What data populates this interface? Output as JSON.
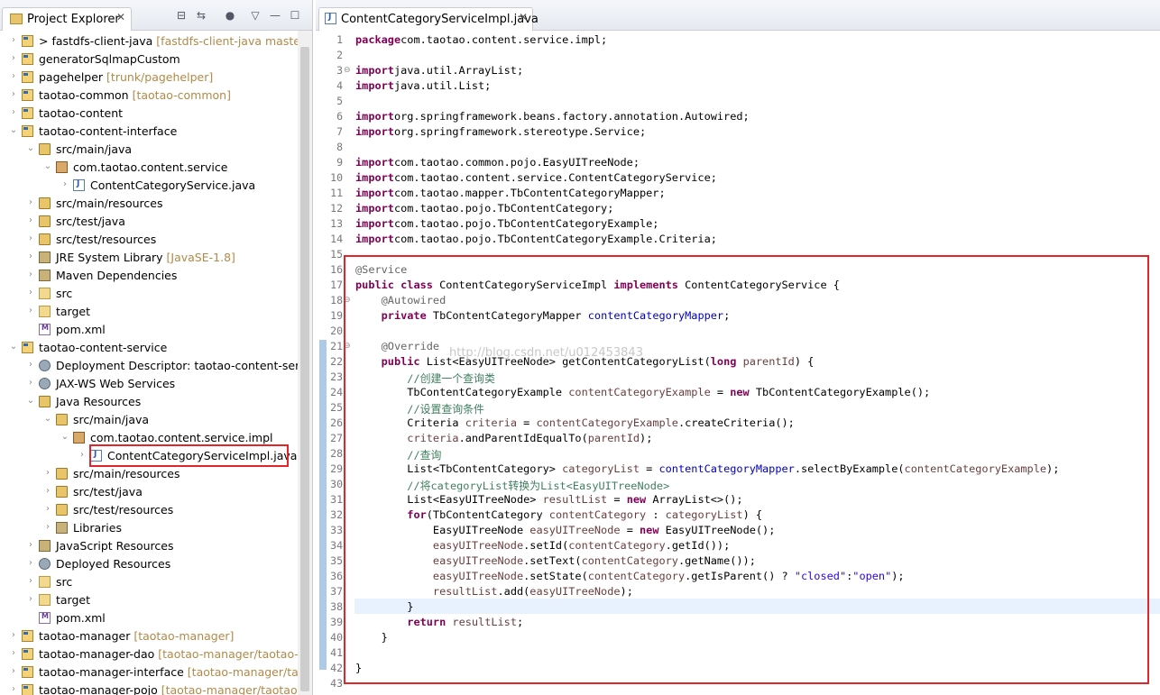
{
  "explorer": {
    "title": "Project Explorer",
    "tree": [
      {
        "label": "> fastdfs-client-java",
        "deco": " [fastdfs-client-java master]",
        "icon": "maven-project-icon",
        "depth": 0,
        "expanded": false
      },
      {
        "label": "generatorSqlmapCustom",
        "deco": "",
        "icon": "project-icon",
        "depth": 0,
        "expanded": false
      },
      {
        "label": "pagehelper",
        "deco": " [trunk/pagehelper]",
        "icon": "maven-project-icon",
        "depth": 0,
        "expanded": false
      },
      {
        "label": "taotao-common",
        "deco": " [taotao-common]",
        "icon": "maven-project-icon",
        "depth": 0,
        "expanded": false
      },
      {
        "label": "taotao-content",
        "deco": "",
        "icon": "maven-project-icon",
        "depth": 0,
        "expanded": false
      },
      {
        "label": "taotao-content-interface",
        "deco": "",
        "icon": "maven-project-icon",
        "depth": 0,
        "expanded": true
      },
      {
        "label": "src/main/java",
        "deco": "",
        "icon": "source-folder-icon",
        "depth": 1,
        "expanded": true
      },
      {
        "label": "com.taotao.content.service",
        "deco": "",
        "icon": "package-icon",
        "depth": 2,
        "expanded": true
      },
      {
        "label": "ContentCategoryService.java",
        "deco": "",
        "icon": "java-file-icon",
        "depth": 3,
        "expanded": false
      },
      {
        "label": "src/main/resources",
        "deco": "",
        "icon": "source-folder-icon",
        "depth": 1,
        "expanded": false
      },
      {
        "label": "src/test/java",
        "deco": "",
        "icon": "source-folder-icon",
        "depth": 1,
        "expanded": false
      },
      {
        "label": "src/test/resources",
        "deco": "",
        "icon": "source-folder-icon",
        "depth": 1,
        "expanded": false
      },
      {
        "label": "JRE System Library",
        "deco": " [JavaSE-1.8]",
        "icon": "library-icon",
        "depth": 1,
        "expanded": false
      },
      {
        "label": "Maven Dependencies",
        "deco": "",
        "icon": "library-icon",
        "depth": 1,
        "expanded": false
      },
      {
        "label": "src",
        "deco": "",
        "icon": "folder-icon",
        "depth": 1,
        "expanded": false
      },
      {
        "label": "target",
        "deco": "",
        "icon": "folder-icon",
        "depth": 1,
        "expanded": false
      },
      {
        "label": "pom.xml",
        "deco": "",
        "icon": "xml-file-icon",
        "depth": 1,
        "leaf": true
      },
      {
        "label": "taotao-content-service",
        "deco": "",
        "icon": "maven-project-icon",
        "depth": 0,
        "expanded": true
      },
      {
        "label": "Deployment Descriptor: taotao-content-servi",
        "deco": "",
        "icon": "deployment-icon",
        "depth": 1,
        "expanded": false
      },
      {
        "label": "JAX-WS Web Services",
        "deco": "",
        "icon": "webservice-icon",
        "depth": 1,
        "expanded": false
      },
      {
        "label": "Java Resources",
        "deco": "",
        "icon": "java-resources-icon",
        "depth": 1,
        "expanded": true
      },
      {
        "label": "src/main/java",
        "deco": "",
        "icon": "source-folder-icon",
        "depth": 2,
        "expanded": true
      },
      {
        "label": "com.taotao.content.service.impl",
        "deco": "",
        "icon": "package-icon",
        "depth": 3,
        "expanded": true
      },
      {
        "label": "ContentCategoryServiceImpl.java",
        "deco": "",
        "icon": "java-file-icon",
        "depth": 4,
        "expanded": false,
        "selected": true
      },
      {
        "label": "src/main/resources",
        "deco": "",
        "icon": "source-folder-icon",
        "depth": 2,
        "expanded": false
      },
      {
        "label": "src/test/java",
        "deco": "",
        "icon": "source-folder-icon",
        "depth": 2,
        "expanded": false
      },
      {
        "label": "src/test/resources",
        "deco": "",
        "icon": "source-folder-icon",
        "depth": 2,
        "expanded": false
      },
      {
        "label": "Libraries",
        "deco": "",
        "icon": "library-icon",
        "depth": 2,
        "expanded": false
      },
      {
        "label": "JavaScript Resources",
        "deco": "",
        "icon": "javascript-icon",
        "depth": 1,
        "expanded": false
      },
      {
        "label": "Deployed Resources",
        "deco": "",
        "icon": "deployed-icon",
        "depth": 1,
        "expanded": false
      },
      {
        "label": "src",
        "deco": "",
        "icon": "folder-icon",
        "depth": 1,
        "expanded": false
      },
      {
        "label": "target",
        "deco": "",
        "icon": "folder-icon",
        "depth": 1,
        "expanded": false
      },
      {
        "label": "pom.xml",
        "deco": "",
        "icon": "xml-file-icon",
        "depth": 1,
        "leaf": true
      },
      {
        "label": "taotao-manager",
        "deco": " [taotao-manager]",
        "icon": "maven-project-icon",
        "depth": 0,
        "expanded": false
      },
      {
        "label": "taotao-manager-dao",
        "deco": " [taotao-manager/taotao-m",
        "icon": "maven-project-icon",
        "depth": 0,
        "expanded": false
      },
      {
        "label": "taotao-manager-interface",
        "deco": " [taotao-manager/taot",
        "icon": "maven-project-icon",
        "depth": 0,
        "expanded": false
      },
      {
        "label": "taotao-manager-pojo",
        "deco": " [taotao-manager/taotao-",
        "icon": "maven-project-icon",
        "depth": 0,
        "expanded": false
      }
    ]
  },
  "editor": {
    "tab_title": "ContentCategoryServiceImpl.java",
    "watermark": "http://blog.csdn.net/u012453843",
    "lines": [
      {
        "n": "1",
        "t": [
          [
            "kw",
            "package"
          ],
          [
            "",
            "com.taotao.content.service.impl;"
          ]
        ]
      },
      {
        "n": "2",
        "t": []
      },
      {
        "n": "3",
        "fold": true,
        "t": [
          [
            "kw",
            "import"
          ],
          [
            "",
            "java.util.ArrayList;"
          ]
        ]
      },
      {
        "n": "4",
        "t": [
          [
            "kw",
            "import"
          ],
          [
            "",
            "java.util.List;"
          ]
        ]
      },
      {
        "n": "5",
        "t": []
      },
      {
        "n": "6",
        "t": [
          [
            "kw",
            "import"
          ],
          [
            "",
            "org.springframework.beans.factory.annotation.Autowired;"
          ]
        ]
      },
      {
        "n": "7",
        "t": [
          [
            "kw",
            "import"
          ],
          [
            "",
            "org.springframework.stereotype.Service;"
          ]
        ]
      },
      {
        "n": "8",
        "t": []
      },
      {
        "n": "9",
        "t": [
          [
            "kw",
            "import"
          ],
          [
            "",
            "com.taotao.common.pojo.EasyUITreeNode;"
          ]
        ]
      },
      {
        "n": "10",
        "t": [
          [
            "kw",
            "import"
          ],
          [
            "",
            "com.taotao.content.service.ContentCategoryService;"
          ]
        ]
      },
      {
        "n": "11",
        "t": [
          [
            "kw",
            "import"
          ],
          [
            "",
            "com.taotao.mapper.TbContentCategoryMapper;"
          ]
        ]
      },
      {
        "n": "12",
        "t": [
          [
            "kw",
            "import"
          ],
          [
            "",
            "com.taotao.pojo.TbContentCategory;"
          ]
        ]
      },
      {
        "n": "13",
        "t": [
          [
            "kw",
            "import"
          ],
          [
            "",
            "com.taotao.pojo.TbContentCategoryExample;"
          ]
        ]
      },
      {
        "n": "14",
        "t": [
          [
            "kw",
            "import"
          ],
          [
            "",
            "com.taotao.pojo.TbContentCategoryExample.Criteria;"
          ]
        ]
      },
      {
        "n": "15",
        "t": []
      },
      {
        "n": "16",
        "t": [
          [
            "ann",
            "@Service"
          ]
        ]
      },
      {
        "n": "17",
        "t": [
          [
            "kw",
            "public"
          ],
          [
            "",
            " "
          ],
          [
            "kw",
            "class"
          ],
          [
            "",
            " ContentCategoryServiceImpl "
          ],
          [
            "kw",
            "implements"
          ],
          [
            "",
            " ContentCategoryService {"
          ]
        ]
      },
      {
        "n": "18",
        "fold": true,
        "t": [
          [
            "",
            "    "
          ],
          [
            "ann",
            "@Autowired"
          ]
        ]
      },
      {
        "n": "19",
        "t": [
          [
            "",
            "    "
          ],
          [
            "kw",
            "private"
          ],
          [
            "",
            " TbContentCategoryMapper "
          ],
          [
            "fld",
            "contentCategoryMapper"
          ],
          [
            "",
            ";"
          ]
        ]
      },
      {
        "n": "20",
        "t": []
      },
      {
        "n": "21",
        "fold": true,
        "t": [
          [
            "",
            "    "
          ],
          [
            "ann",
            "@Override"
          ]
        ]
      },
      {
        "n": "22",
        "t": [
          [
            "",
            "    "
          ],
          [
            "kw",
            "public"
          ],
          [
            "",
            " List<EasyUITreeNode> getContentCategoryList("
          ],
          [
            "kw",
            "long"
          ],
          [
            "",
            " "
          ],
          [
            "var",
            "parentId"
          ],
          [
            "",
            ") {"
          ]
        ]
      },
      {
        "n": "23",
        "t": [
          [
            "",
            "        "
          ],
          [
            "cmt",
            "//创建一个查询类"
          ]
        ]
      },
      {
        "n": "24",
        "t": [
          [
            "",
            "        TbContentCategoryExample "
          ],
          [
            "var",
            "contentCategoryExample"
          ],
          [
            "",
            " = "
          ],
          [
            "kw",
            "new"
          ],
          [
            "",
            " TbContentCategoryExample();"
          ]
        ]
      },
      {
        "n": "25",
        "t": [
          [
            "",
            "        "
          ],
          [
            "cmt",
            "//设置查询条件"
          ]
        ]
      },
      {
        "n": "26",
        "t": [
          [
            "",
            "        Criteria "
          ],
          [
            "var",
            "criteria"
          ],
          [
            "",
            " = "
          ],
          [
            "var",
            "contentCategoryExample"
          ],
          [
            "",
            ".createCriteria();"
          ]
        ]
      },
      {
        "n": "27",
        "t": [
          [
            "",
            "        "
          ],
          [
            "var",
            "criteria"
          ],
          [
            "",
            ".andParentIdEqualTo("
          ],
          [
            "var",
            "parentId"
          ],
          [
            "",
            ");"
          ]
        ]
      },
      {
        "n": "28",
        "t": [
          [
            "",
            "        "
          ],
          [
            "cmt",
            "//查询"
          ]
        ]
      },
      {
        "n": "29",
        "t": [
          [
            "",
            "        List<TbContentCategory> "
          ],
          [
            "var",
            "categoryList"
          ],
          [
            "",
            " = "
          ],
          [
            "fld",
            "contentCategoryMapper"
          ],
          [
            "",
            ".selectByExample("
          ],
          [
            "var",
            "contentCategoryExample"
          ],
          [
            "",
            ");"
          ]
        ]
      },
      {
        "n": "30",
        "t": [
          [
            "",
            "        "
          ],
          [
            "cmt",
            "//将categoryList转换为List<EasyUITreeNode>"
          ]
        ]
      },
      {
        "n": "31",
        "t": [
          [
            "",
            "        List<EasyUITreeNode> "
          ],
          [
            "var",
            "resultList"
          ],
          [
            "",
            " = "
          ],
          [
            "kw",
            "new"
          ],
          [
            "",
            " ArrayList<>();"
          ]
        ]
      },
      {
        "n": "32",
        "t": [
          [
            "",
            "        "
          ],
          [
            "kw",
            "for"
          ],
          [
            "",
            "(TbContentCategory "
          ],
          [
            "var",
            "contentCategory"
          ],
          [
            "",
            " : "
          ],
          [
            "var",
            "categoryList"
          ],
          [
            "",
            ") {"
          ]
        ]
      },
      {
        "n": "33",
        "t": [
          [
            "",
            "            EasyUITreeNode "
          ],
          [
            "var",
            "easyUITreeNode"
          ],
          [
            "",
            " = "
          ],
          [
            "kw",
            "new"
          ],
          [
            "",
            " EasyUITreeNode();"
          ]
        ]
      },
      {
        "n": "34",
        "t": [
          [
            "",
            "            "
          ],
          [
            "var",
            "easyUITreeNode"
          ],
          [
            "",
            ".setId("
          ],
          [
            "var",
            "contentCategory"
          ],
          [
            "",
            ".getId());"
          ]
        ]
      },
      {
        "n": "35",
        "t": [
          [
            "",
            "            "
          ],
          [
            "var",
            "easyUITreeNode"
          ],
          [
            "",
            ".setText("
          ],
          [
            "var",
            "contentCategory"
          ],
          [
            "",
            ".getName());"
          ]
        ]
      },
      {
        "n": "36",
        "t": [
          [
            "",
            "            "
          ],
          [
            "var",
            "easyUITreeNode"
          ],
          [
            "",
            ".setState("
          ],
          [
            "var",
            "contentCategory"
          ],
          [
            "",
            ".getIsParent() ? "
          ],
          [
            "str",
            "\"closed\""
          ],
          [
            "",
            ":"
          ],
          [
            "str",
            "\"open\""
          ],
          [
            "",
            ");"
          ]
        ]
      },
      {
        "n": "37",
        "t": [
          [
            "",
            "            "
          ],
          [
            "var",
            "resultList"
          ],
          [
            "",
            ".add("
          ],
          [
            "var",
            "easyUITreeNode"
          ],
          [
            "",
            ");"
          ]
        ]
      },
      {
        "n": "38",
        "t": [
          [
            "",
            "        }"
          ]
        ]
      },
      {
        "n": "39",
        "t": [
          [
            "",
            "        "
          ],
          [
            "kw",
            "return"
          ],
          [
            "",
            " "
          ],
          [
            "var",
            "resultList"
          ],
          [
            "",
            ";"
          ]
        ]
      },
      {
        "n": "40",
        "t": [
          [
            "",
            "    }"
          ]
        ]
      },
      {
        "n": "41",
        "t": []
      },
      {
        "n": "42",
        "t": [
          [
            "",
            "}"
          ]
        ]
      },
      {
        "n": "43",
        "t": []
      }
    ]
  }
}
